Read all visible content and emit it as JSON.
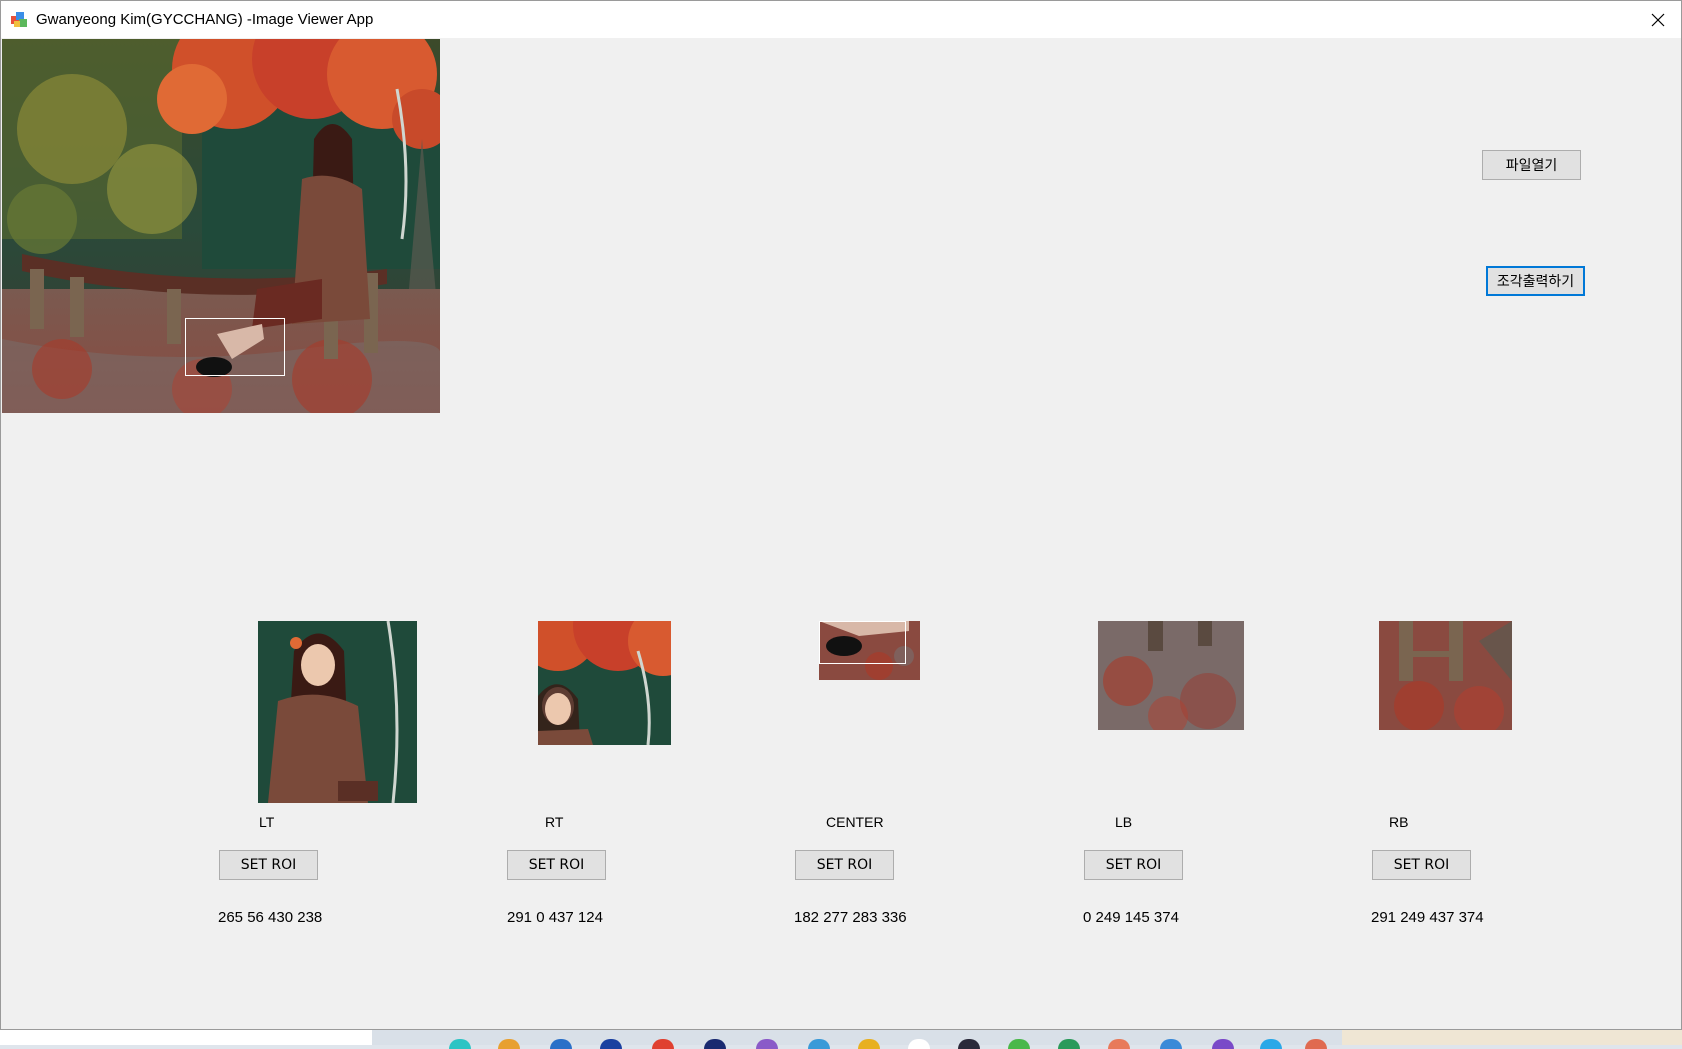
{
  "window": {
    "title": "Gwanyeong Kim(GYCCHANG) -Image Viewer App"
  },
  "buttons": {
    "open_file": "파일열기",
    "output_pieces": "조각출력하기"
  },
  "pieces": [
    {
      "label": "LT",
      "button": "SET ROI",
      "coords": "265 56 430 238"
    },
    {
      "label": "RT",
      "button": "SET ROI",
      "coords": "291 0 437 124"
    },
    {
      "label": "CENTER",
      "button": "SET ROI",
      "coords": "182 277 283 336"
    },
    {
      "label": "LB",
      "button": "SET ROI",
      "coords": "0 249 145 374"
    },
    {
      "label": "RB",
      "button": "SET ROI",
      "coords": "291 249 437 374"
    }
  ],
  "icons": {
    "app": "app-icon",
    "close": "close-icon"
  }
}
